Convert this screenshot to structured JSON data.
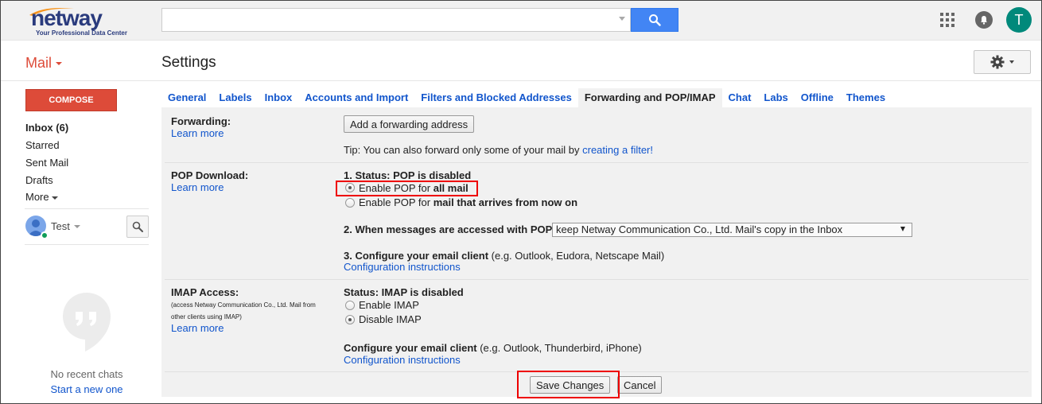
{
  "header": {
    "logo_text": "netway",
    "logo_tagline": "Your Professional Data Center",
    "search": {
      "value": "",
      "placeholder": ""
    },
    "account_initial": "T"
  },
  "subheader": {
    "app_label": "Mail",
    "page_title": "Settings"
  },
  "sidebar": {
    "compose_label": "COMPOSE",
    "items": [
      {
        "label": "Inbox (6)"
      },
      {
        "label": "Starred"
      },
      {
        "label": "Sent Mail"
      },
      {
        "label": "Drafts"
      },
      {
        "label": "More"
      }
    ],
    "user_name": "Test",
    "no_chats": "No recent chats",
    "start_chat": "Start a new one"
  },
  "tabs": [
    {
      "label": "General"
    },
    {
      "label": "Labels"
    },
    {
      "label": "Inbox"
    },
    {
      "label": "Accounts and Import"
    },
    {
      "label": "Filters and Blocked Addresses"
    },
    {
      "label": "Forwarding and POP/IMAP",
      "active": true
    },
    {
      "label": "Chat"
    },
    {
      "label": "Labs"
    },
    {
      "label": "Offline"
    },
    {
      "label": "Themes"
    }
  ],
  "forwarding": {
    "label": "Forwarding:",
    "learn_more": "Learn more",
    "add_button": "Add a forwarding address",
    "tip_prefix": "Tip: You can also forward only some of your mail by ",
    "tip_link": "creating a filter!"
  },
  "pop": {
    "label": "POP Download:",
    "learn_more": "Learn more",
    "status": "1. Status: POP is disabled",
    "option_all_prefix": "Enable POP for ",
    "option_all_bold": "all mail",
    "option_new_prefix": "Enable POP for ",
    "option_new_bold": "mail that arrives from now on",
    "selected_option": "all mail",
    "access_label": "2. When messages are accessed with POP",
    "access_select_value": "keep Netway Communication Co., Ltd. Mail's copy in the Inbox",
    "configure_bold": "3. Configure your email client",
    "configure_rest": " (e.g. Outlook, Eudora, Netscape Mail)",
    "configure_link": "Configuration instructions"
  },
  "imap": {
    "label": "IMAP Access:",
    "note": "(access Netway Communication Co., Ltd. Mail from other clients using IMAP)",
    "learn_more": "Learn more",
    "status": "Status: IMAP is disabled",
    "option_enable": "Enable IMAP",
    "option_disable": "Disable IMAP",
    "selected_option": "Disable IMAP",
    "configure_bold": "Configure your email client",
    "configure_rest": " (e.g. Outlook, Thunderbird, iPhone)",
    "configure_link": "Configuration instructions"
  },
  "footer": {
    "save_label": "Save Changes",
    "cancel_label": "Cancel"
  },
  "colors": {
    "compose": "#dd4b39",
    "link": "#1155cc",
    "search_button": "#4285f4",
    "highlight_box": "#ee0000",
    "avatar": "#00897b"
  },
  "icons": [
    "search-icon",
    "apps-grid-icon",
    "notifications-icon",
    "gear-icon",
    "user-avatar-icon",
    "chat-search-icon",
    "hangouts-icon"
  ]
}
